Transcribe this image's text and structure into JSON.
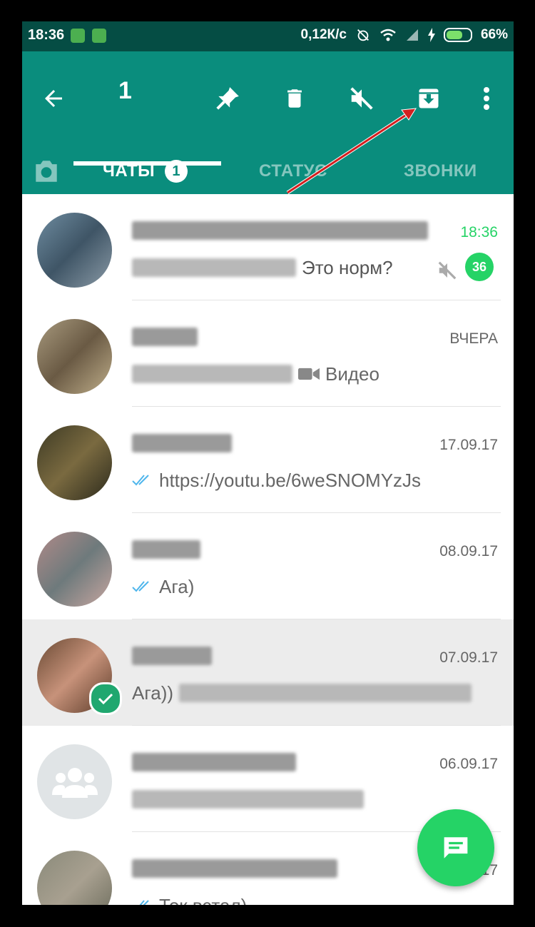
{
  "status_bar": {
    "time": "18:36",
    "speed": "0,12К/с",
    "battery": "66%"
  },
  "action_bar": {
    "selected_count": "1"
  },
  "tabs": {
    "chats_label": "ЧАТЫ",
    "chats_badge": "1",
    "status_label": "СТАТУС",
    "calls_label": "ЗВОНКИ"
  },
  "chats": [
    {
      "time": "18:36",
      "message": "Это норм?",
      "unread": "36",
      "muted": true,
      "time_color": "#25d366"
    },
    {
      "time": "ВЧЕРА",
      "message": "Видео"
    },
    {
      "time": "17.09.17",
      "message": "https://youtu.be/6weSNOMYzJs",
      "read": true
    },
    {
      "time": "08.09.17",
      "message": "Ага)",
      "read": true
    },
    {
      "time": "07.09.17",
      "message": "Ага))",
      "selected": true
    },
    {
      "time": "06.09.17",
      "message": ""
    },
    {
      "time": "17",
      "message": "Ток встал)",
      "read": true
    }
  ],
  "colors": {
    "toolbar": "#0a8d7d",
    "status_bar": "#054d44",
    "accent": "#25d366"
  }
}
